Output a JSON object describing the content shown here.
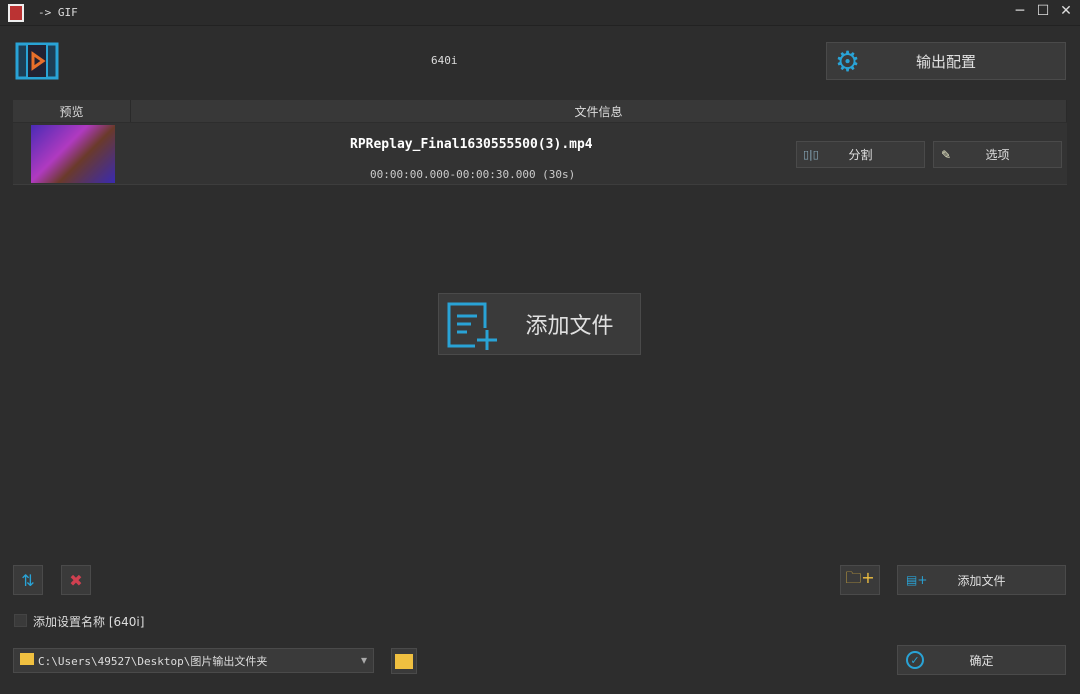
{
  "window": {
    "title": "-> GIF",
    "minimize": "─",
    "maximize": "☐",
    "close": "✕"
  },
  "toolbar": {
    "preset": "640i",
    "output_config": "输出配置"
  },
  "table": {
    "headers": [
      "预览",
      "文件信息"
    ],
    "rows": [
      {
        "filename": "RPReplay_Final1630555500(3).mp4",
        "duration": "00:00:00.000-00:00:30.000 (30s)",
        "split": "分割",
        "options": "选项"
      }
    ]
  },
  "center": {
    "add_file": "添加文件"
  },
  "bottom": {
    "add_setting_name": "添加设置名称 [640i]",
    "output_path": "C:\\Users\\49527\\Desktop\\图片输出文件夹",
    "add_file": "添加文件",
    "confirm": "确定",
    "dropdown_arrow": "▾"
  },
  "colors": {
    "accent": "#29a3d6",
    "danger": "#d04050",
    "folder": "#f0c040"
  }
}
